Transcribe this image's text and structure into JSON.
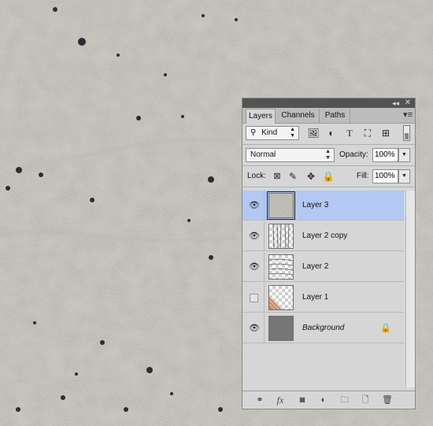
{
  "panel": {
    "collapse_label": "◂◂",
    "close_label": "✕",
    "menu_icon": "panel-menu-icon",
    "tabs": [
      {
        "label": "Layers",
        "active": true
      },
      {
        "label": "Channels",
        "active": false
      },
      {
        "label": "Paths",
        "active": false
      }
    ]
  },
  "filter": {
    "kind_label": "Kind",
    "search_symbol": "⚲",
    "icons": [
      "pixel-filter-icon",
      "adjustment-filter-icon",
      "type-filter-icon",
      "shape-filter-icon",
      "smart-object-filter-icon"
    ]
  },
  "blend": {
    "mode": "Normal",
    "opacity_label": "Opacity:",
    "opacity_value": "100%",
    "lock_label": "Lock:",
    "fill_label": "Fill:",
    "fill_value": "100%"
  },
  "layers": [
    {
      "name": "Layer 3",
      "visible": true,
      "selected": true,
      "thumb": "texture",
      "italic": false,
      "locked": false
    },
    {
      "name": "Layer 2 copy",
      "visible": true,
      "selected": false,
      "thumb": "lines",
      "italic": false,
      "locked": false
    },
    {
      "name": "Layer 2",
      "visible": true,
      "selected": false,
      "thumb": "waves",
      "italic": false,
      "locked": false
    },
    {
      "name": "Layer 1",
      "visible": false,
      "selected": false,
      "thumb": "corner",
      "italic": false,
      "locked": false
    },
    {
      "name": "Background",
      "visible": true,
      "selected": false,
      "thumb": "gray",
      "italic": true,
      "locked": true
    }
  ],
  "footer": {
    "fx_label": "fx",
    "icons": [
      "link-layers-icon",
      "fx-icon",
      "layer-mask-icon",
      "adjustment-layer-icon",
      "new-group-icon",
      "new-layer-icon",
      "trash-icon"
    ]
  },
  "colors": {
    "selected_row": "#b3c9f4",
    "panel_bg": "#d6d6d6",
    "titlebar": "#535353"
  }
}
